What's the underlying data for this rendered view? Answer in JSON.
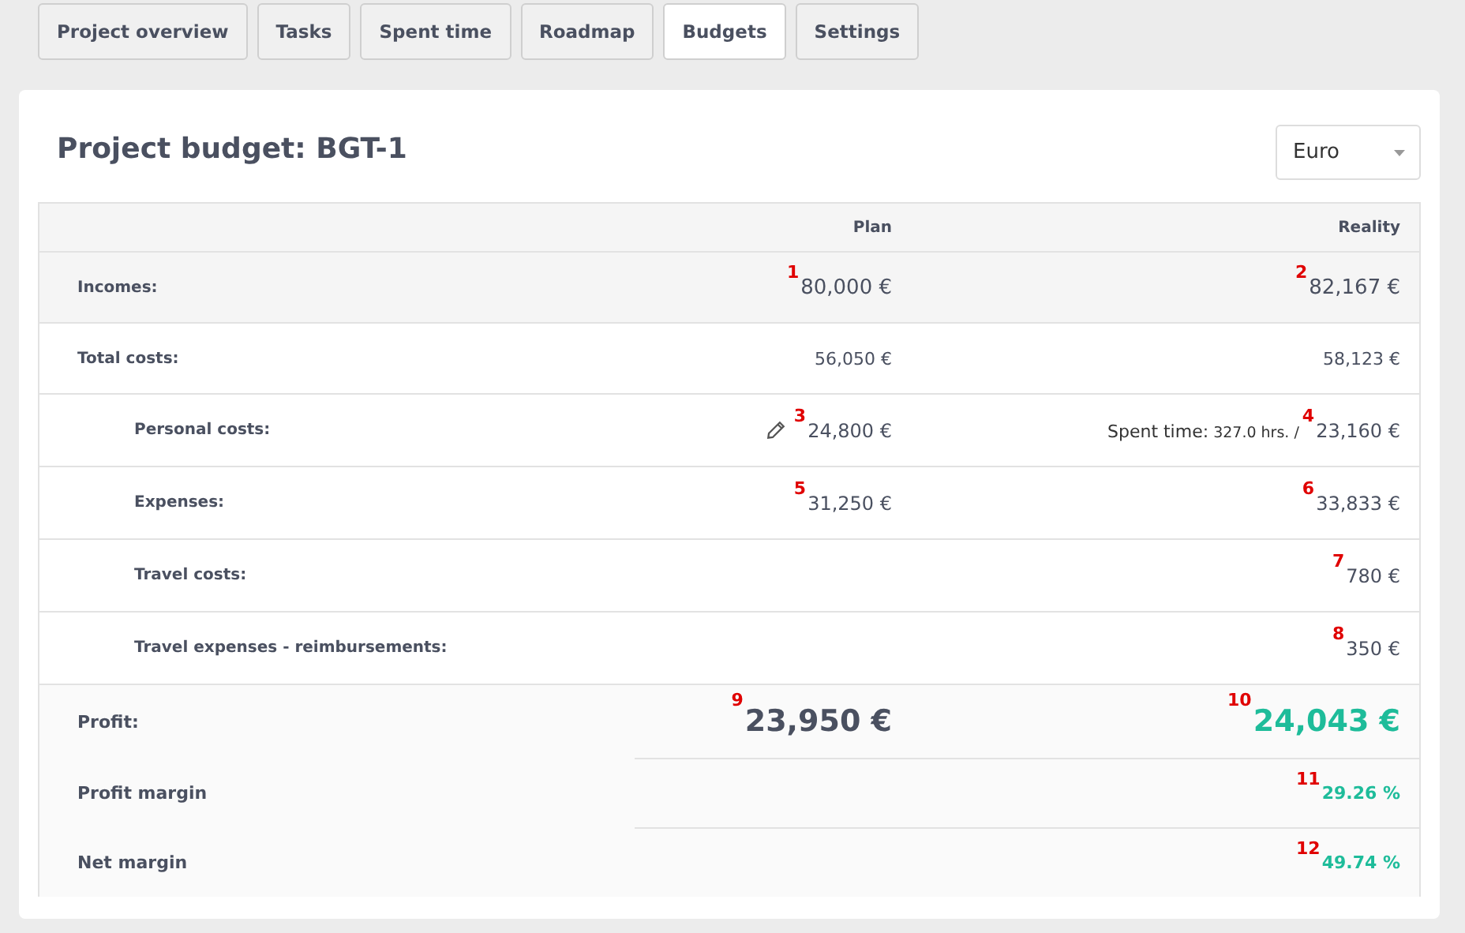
{
  "tabs": [
    {
      "label": "Project overview",
      "selected": false
    },
    {
      "label": "Tasks",
      "selected": false
    },
    {
      "label": "Spent time",
      "selected": false
    },
    {
      "label": "Roadmap",
      "selected": false
    },
    {
      "label": "Budgets",
      "selected": true
    },
    {
      "label": "Settings",
      "selected": false
    }
  ],
  "title": "Project budget: BGT-1",
  "currency_select": {
    "value": "Euro"
  },
  "table": {
    "columns": [
      "Plan",
      "Reality"
    ],
    "rows": [
      {
        "label": "Incomes:",
        "kind": "main",
        "shaded": true,
        "plan": "80,000 €",
        "plan_marker": "1",
        "reality": "82,167 €",
        "reality_marker": "2"
      },
      {
        "label": "Total costs:",
        "kind": "main",
        "shaded": false,
        "plan": "56,050 €",
        "reality": "58,123 €"
      },
      {
        "label": "Personal costs:",
        "kind": "sub",
        "shaded": false,
        "plan": "24,800 €",
        "plan_marker": "3",
        "plan_editable": true,
        "reality": "23,160 €",
        "reality_marker": "4",
        "reality_note": "Spent time:",
        "reality_note_value": "327.0 hrs. /"
      },
      {
        "label": "Expenses:",
        "kind": "sub",
        "shaded": false,
        "plan": "31,250 €",
        "plan_marker": "5",
        "reality": "33,833 €",
        "reality_marker": "6"
      },
      {
        "label": "Travel costs:",
        "kind": "sub",
        "shaded": false,
        "reality": "780 €",
        "reality_marker": "7"
      },
      {
        "label": "Travel expenses - reimbursements:",
        "kind": "sub",
        "shaded": false,
        "reality": "350 €",
        "reality_marker": "8"
      }
    ],
    "summary": [
      {
        "label": "Profit:",
        "kind": "large",
        "plan": "23,950 €",
        "plan_marker": "9",
        "reality": "24,043 €",
        "reality_marker": "10",
        "positive": true
      },
      {
        "label": "Profit margin",
        "kind": "small",
        "reality": "29.26 %",
        "reality_marker": "11",
        "positive": true
      },
      {
        "label": "Net margin",
        "kind": "small",
        "reality": "49.74 %",
        "reality_marker": "12",
        "positive": true
      }
    ]
  }
}
